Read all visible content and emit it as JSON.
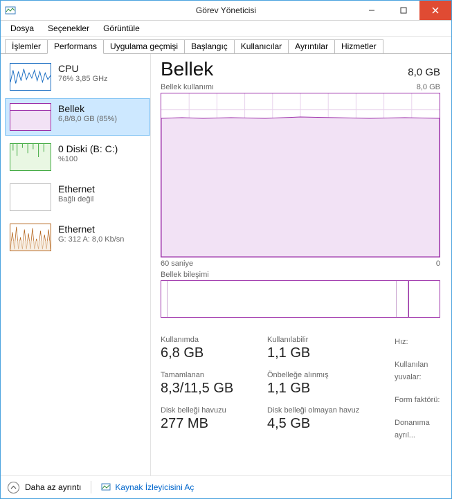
{
  "window": {
    "title": "Görev Yöneticisi"
  },
  "menu": {
    "file": "Dosya",
    "options": "Seçenekler",
    "view": "Görüntüle"
  },
  "tabs": [
    "İşlemler",
    "Performans",
    "Uygulama geçmişi",
    "Başlangıç",
    "Kullanıcılar",
    "Ayrıntılar",
    "Hizmetler"
  ],
  "active_tab": 1,
  "sidebar": {
    "items": [
      {
        "id": "cpu",
        "label": "CPU",
        "sub": "76% 3,85 GHz"
      },
      {
        "id": "mem",
        "label": "Bellek",
        "sub": "6,8/8,0 GB (85%)"
      },
      {
        "id": "disk",
        "label": "0 Diski (B: C:)",
        "sub": "%100"
      },
      {
        "id": "eth0",
        "label": "Ethernet",
        "sub": "Bağlı değil"
      },
      {
        "id": "eth1",
        "label": "Ethernet",
        "sub": "G: 312 A: 8,0 Kb/sn"
      }
    ],
    "selected": 1
  },
  "main": {
    "heading": "Bellek",
    "total": "8,0 GB",
    "chart_label": "Bellek kullanımı",
    "chart_max_label": "8,0 GB",
    "xaxis_left": "60 saniye",
    "xaxis_right": "0",
    "composition_label": "Bellek bileşimi",
    "composition_segments": [
      0.02,
      0.83,
      0.04,
      0.11
    ],
    "metrics": {
      "col1": [
        {
          "lbl": "Kullanımda",
          "val": "6,8 GB"
        },
        {
          "lbl": "Tamamlanan",
          "val": "8,3/11,5 GB"
        },
        {
          "lbl": "Disk belleği havuzu",
          "val": "277 MB"
        }
      ],
      "col2": [
        {
          "lbl": "Kullanılabilir",
          "val": "1,1 GB"
        },
        {
          "lbl": "Önbelleğe alınmış",
          "val": "1,1 GB"
        },
        {
          "lbl": "Disk belleği olmayan havuz",
          "val": "4,5 GB"
        }
      ],
      "right_labels": [
        "Hız:",
        "Kullanılan yuvalar:",
        "Form faktörü:",
        "Donanıma ayrıl..."
      ]
    }
  },
  "footer": {
    "fewer": "Daha az ayrıntı",
    "link": "Kaynak İzleyicisini Aç"
  },
  "colors": {
    "accent_purple": "#9b2da8",
    "accent_blue": "#1b6ec2",
    "accent_green": "#3fa93f",
    "accent_brown": "#b5651d",
    "selection_bg": "#cde8ff",
    "selection_border": "#7ec1f3",
    "close_bg": "#e04b33"
  },
  "chart_data": {
    "type": "area",
    "title": "Bellek kullanımı",
    "ylabel": "GB",
    "ylim": [
      0,
      8.0
    ],
    "xlabel_left": "60 saniye",
    "xlabel_right": "0",
    "x": [
      0,
      5,
      10,
      15,
      20,
      25,
      30,
      35,
      40,
      45,
      50,
      55,
      60
    ],
    "values": [
      6.8,
      6.8,
      6.8,
      6.8,
      6.8,
      6.8,
      6.8,
      6.8,
      6.8,
      6.8,
      6.8,
      6.8,
      6.8
    ]
  }
}
